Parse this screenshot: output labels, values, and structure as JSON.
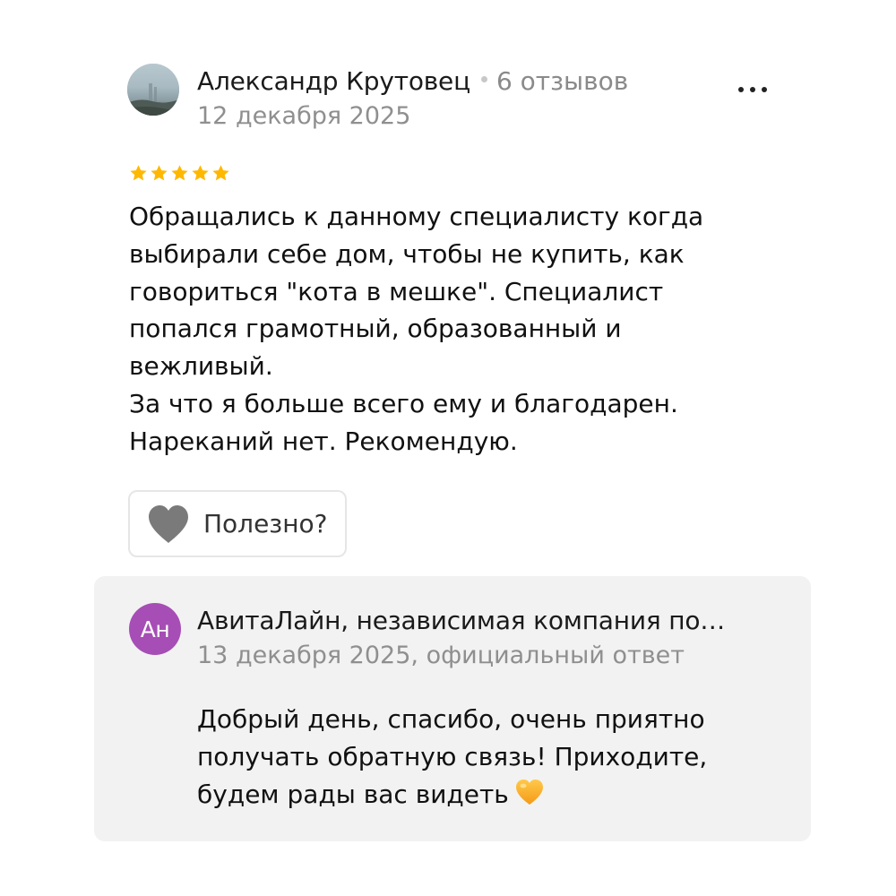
{
  "review": {
    "author": {
      "name": "Александр Крутовец",
      "reviews_count": "6 отзывов",
      "avatar_icon": "landscape-photo-avatar"
    },
    "date": "12 декабря 2025",
    "rating": 5,
    "rating_max": 5,
    "star_color": "#ffb800",
    "text_lines": [
      "Обращались к данному специалисту когда",
      "выбирали себе дом, чтобы не купить, как",
      "говориться \"кота в мешке\". Специалист",
      "попался грамотный, образованный и",
      "вежливый.",
      "За что я больше всего ему и благодарен.",
      "Нареканий нет. Рекомендую."
    ],
    "useful_button": {
      "label": "Полезно?",
      "icon": "heart-icon"
    },
    "more_icon": "more-dots-icon"
  },
  "reply": {
    "avatar_initials": "Ан",
    "avatar_color": "#a64eb5",
    "author": "АвитаЛайн, независимая компания по…",
    "meta": "13 декабря 2025, официальный ответ",
    "text_lines": [
      "Добрый день, спасибо, очень приятно",
      "получать обратную связь! Приходите,",
      "будем рады вас видеть"
    ],
    "emoji_icon": "orange-heart-emoji-icon"
  }
}
